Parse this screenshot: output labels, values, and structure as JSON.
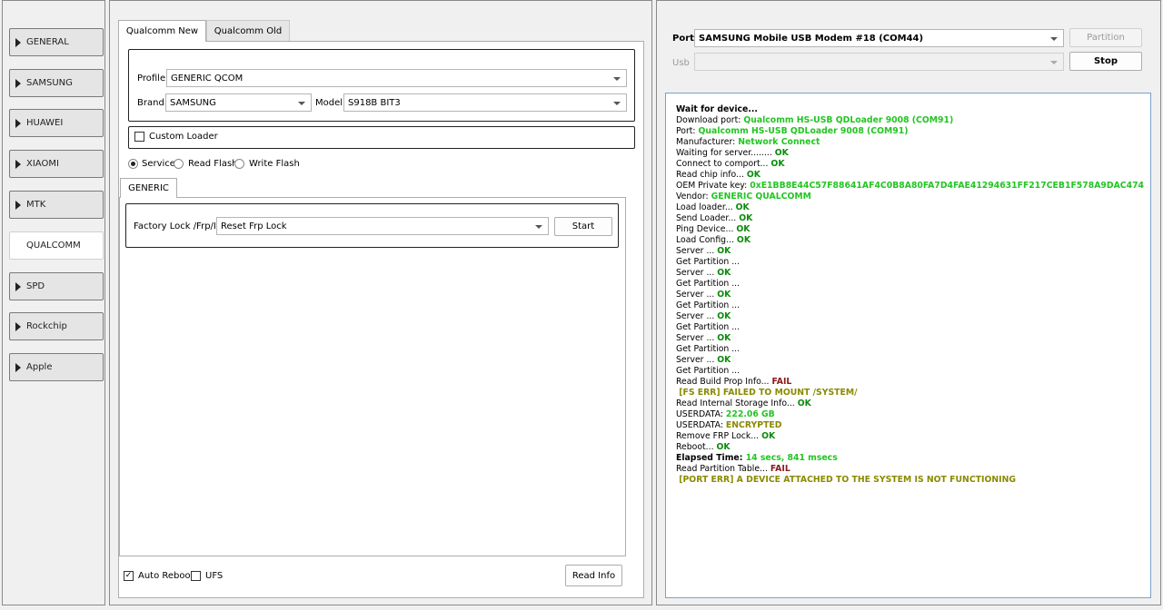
{
  "sidebar": {
    "items": [
      {
        "label": "GENERAL"
      },
      {
        "label": "SAMSUNG"
      },
      {
        "label": "HUAWEI"
      },
      {
        "label": "XIAOMI"
      },
      {
        "label": "MTK"
      },
      {
        "label": "QUALCOMM"
      },
      {
        "label": "SPD"
      },
      {
        "label": "Rockchip"
      },
      {
        "label": "Apple"
      }
    ],
    "active_label": "QUALCOMM"
  },
  "middle": {
    "tabs": [
      {
        "label": "Qualcomm New"
      },
      {
        "label": "Qualcomm Old"
      }
    ],
    "profile_label": "Profile",
    "profile_value": "GENERIC QCOM",
    "brand_label": "Brand",
    "brand_value": "SAMSUNG",
    "model_label": "Model",
    "model_value": "S918B BIT3",
    "custom_loader_label": "Custom Loader",
    "custom_loader_checked": false,
    "modes": [
      {
        "label": "Service",
        "selected": true
      },
      {
        "label": "Read Flash",
        "selected": false
      },
      {
        "label": "Write Flash",
        "selected": false
      }
    ],
    "sub_tab_label": "GENERIC",
    "factory_label": "Factory Lock /Frp/ID",
    "factory_value": "Reset Frp Lock",
    "start_label": "Start",
    "auto_reboot_label": "Auto Reboot",
    "auto_reboot_checked": true,
    "ufs_label": "UFS",
    "ufs_checked": false,
    "read_info_label": "Read Info"
  },
  "right": {
    "port_label": "Port",
    "port_value": "SAMSUNG Mobile USB Modem #18 (COM44)",
    "usb_label": "Usb",
    "usb_value": "",
    "partition_label": "Partition",
    "stop_label": "Stop"
  },
  "colors": {
    "ok": "#0a8c0a",
    "value": "#22c522",
    "fail": "#8b1a1a",
    "error": "#8a8a00",
    "log_border": "#7aa0c8"
  },
  "log": [
    [
      {
        "t": "Wait for device...",
        "c": "bold"
      }
    ],
    [
      {
        "t": "Download port: ",
        "c": "k"
      },
      {
        "t": "Qualcomm HS-USB QDLoader 9008 (COM91)",
        "c": "val"
      }
    ],
    [
      {
        "t": "Port: ",
        "c": "k"
      },
      {
        "t": "Qualcomm HS-USB QDLoader 9008 (COM91)",
        "c": "val"
      }
    ],
    [
      {
        "t": "Manufacturer: ",
        "c": "k"
      },
      {
        "t": "Network Connect",
        "c": "val"
      }
    ],
    [
      {
        "t": "Waiting for server........ ",
        "c": "k"
      },
      {
        "t": "OK",
        "c": "ok"
      }
    ],
    [
      {
        "t": "Connect to comport... ",
        "c": "k"
      },
      {
        "t": "OK",
        "c": "ok"
      }
    ],
    [
      {
        "t": "Read chip info... ",
        "c": "k"
      },
      {
        "t": "OK",
        "c": "ok"
      }
    ],
    [
      {
        "t": "OEM Private key: ",
        "c": "k"
      },
      {
        "t": "0xE1BB8E44C57F88641AF4C0B8A80FA7D4FAE41294631FF217CEB1F578A9DAC474",
        "c": "val"
      }
    ],
    [
      {
        "t": "Vendor: ",
        "c": "k"
      },
      {
        "t": "GENERIC QUALCOMM",
        "c": "val"
      }
    ],
    [
      {
        "t": "Load loader... ",
        "c": "k"
      },
      {
        "t": "OK",
        "c": "ok"
      }
    ],
    [
      {
        "t": "Send Loader... ",
        "c": "k"
      },
      {
        "t": "OK",
        "c": "ok"
      }
    ],
    [
      {
        "t": "Ping Device... ",
        "c": "k"
      },
      {
        "t": "OK",
        "c": "ok"
      }
    ],
    [
      {
        "t": "Load Config... ",
        "c": "k"
      },
      {
        "t": "OK",
        "c": "ok"
      }
    ],
    [
      {
        "t": "Server ... ",
        "c": "k"
      },
      {
        "t": "OK",
        "c": "ok"
      }
    ],
    [
      {
        "t": "Get Partition ...",
        "c": "k"
      }
    ],
    [
      {
        "t": "Server ... ",
        "c": "k"
      },
      {
        "t": "OK",
        "c": "ok"
      }
    ],
    [
      {
        "t": "Get Partition ...",
        "c": "k"
      }
    ],
    [
      {
        "t": "Server ... ",
        "c": "k"
      },
      {
        "t": "OK",
        "c": "ok"
      }
    ],
    [
      {
        "t": "Get Partition ...",
        "c": "k"
      }
    ],
    [
      {
        "t": "Server ... ",
        "c": "k"
      },
      {
        "t": "OK",
        "c": "ok"
      }
    ],
    [
      {
        "t": "Get Partition ...",
        "c": "k"
      }
    ],
    [
      {
        "t": "Server ... ",
        "c": "k"
      },
      {
        "t": "OK",
        "c": "ok"
      }
    ],
    [
      {
        "t": "Get Partition ...",
        "c": "k"
      }
    ],
    [
      {
        "t": "Server ... ",
        "c": "k"
      },
      {
        "t": "OK",
        "c": "ok"
      }
    ],
    [
      {
        "t": "Get Partition ...",
        "c": "k"
      }
    ],
    [
      {
        "t": "Read Build Prop Info... ",
        "c": "k"
      },
      {
        "t": "FAIL",
        "c": "fail"
      }
    ],
    [
      {
        "t": " [FS ERR] FAILED TO MOUNT /SYSTEM/",
        "c": "err"
      }
    ],
    [
      {
        "t": "Read Internal Storage Info... ",
        "c": "k"
      },
      {
        "t": "OK",
        "c": "ok"
      }
    ],
    [
      {
        "t": "USERDATA: ",
        "c": "k"
      },
      {
        "t": "222.06 GB",
        "c": "val"
      }
    ],
    [
      {
        "t": "USERDATA: ",
        "c": "k"
      },
      {
        "t": "ENCRYPTED",
        "c": "err"
      }
    ],
    [
      {
        "t": "Remove FRP Lock... ",
        "c": "k"
      },
      {
        "t": "OK",
        "c": "ok"
      }
    ],
    [
      {
        "t": "Reboot... ",
        "c": "k"
      },
      {
        "t": "OK",
        "c": "ok"
      }
    ],
    [
      {
        "t": "Elapsed Time: ",
        "c": "bold"
      },
      {
        "t": "14 secs, 841 msecs",
        "c": "val"
      }
    ],
    [
      {
        "t": "Read Partition Table... ",
        "c": "k"
      },
      {
        "t": "FAIL",
        "c": "fail"
      }
    ],
    [
      {
        "t": " [PORT ERR] A DEVICE ATTACHED TO THE SYSTEM IS NOT FUNCTIONING",
        "c": "err"
      }
    ]
  ]
}
